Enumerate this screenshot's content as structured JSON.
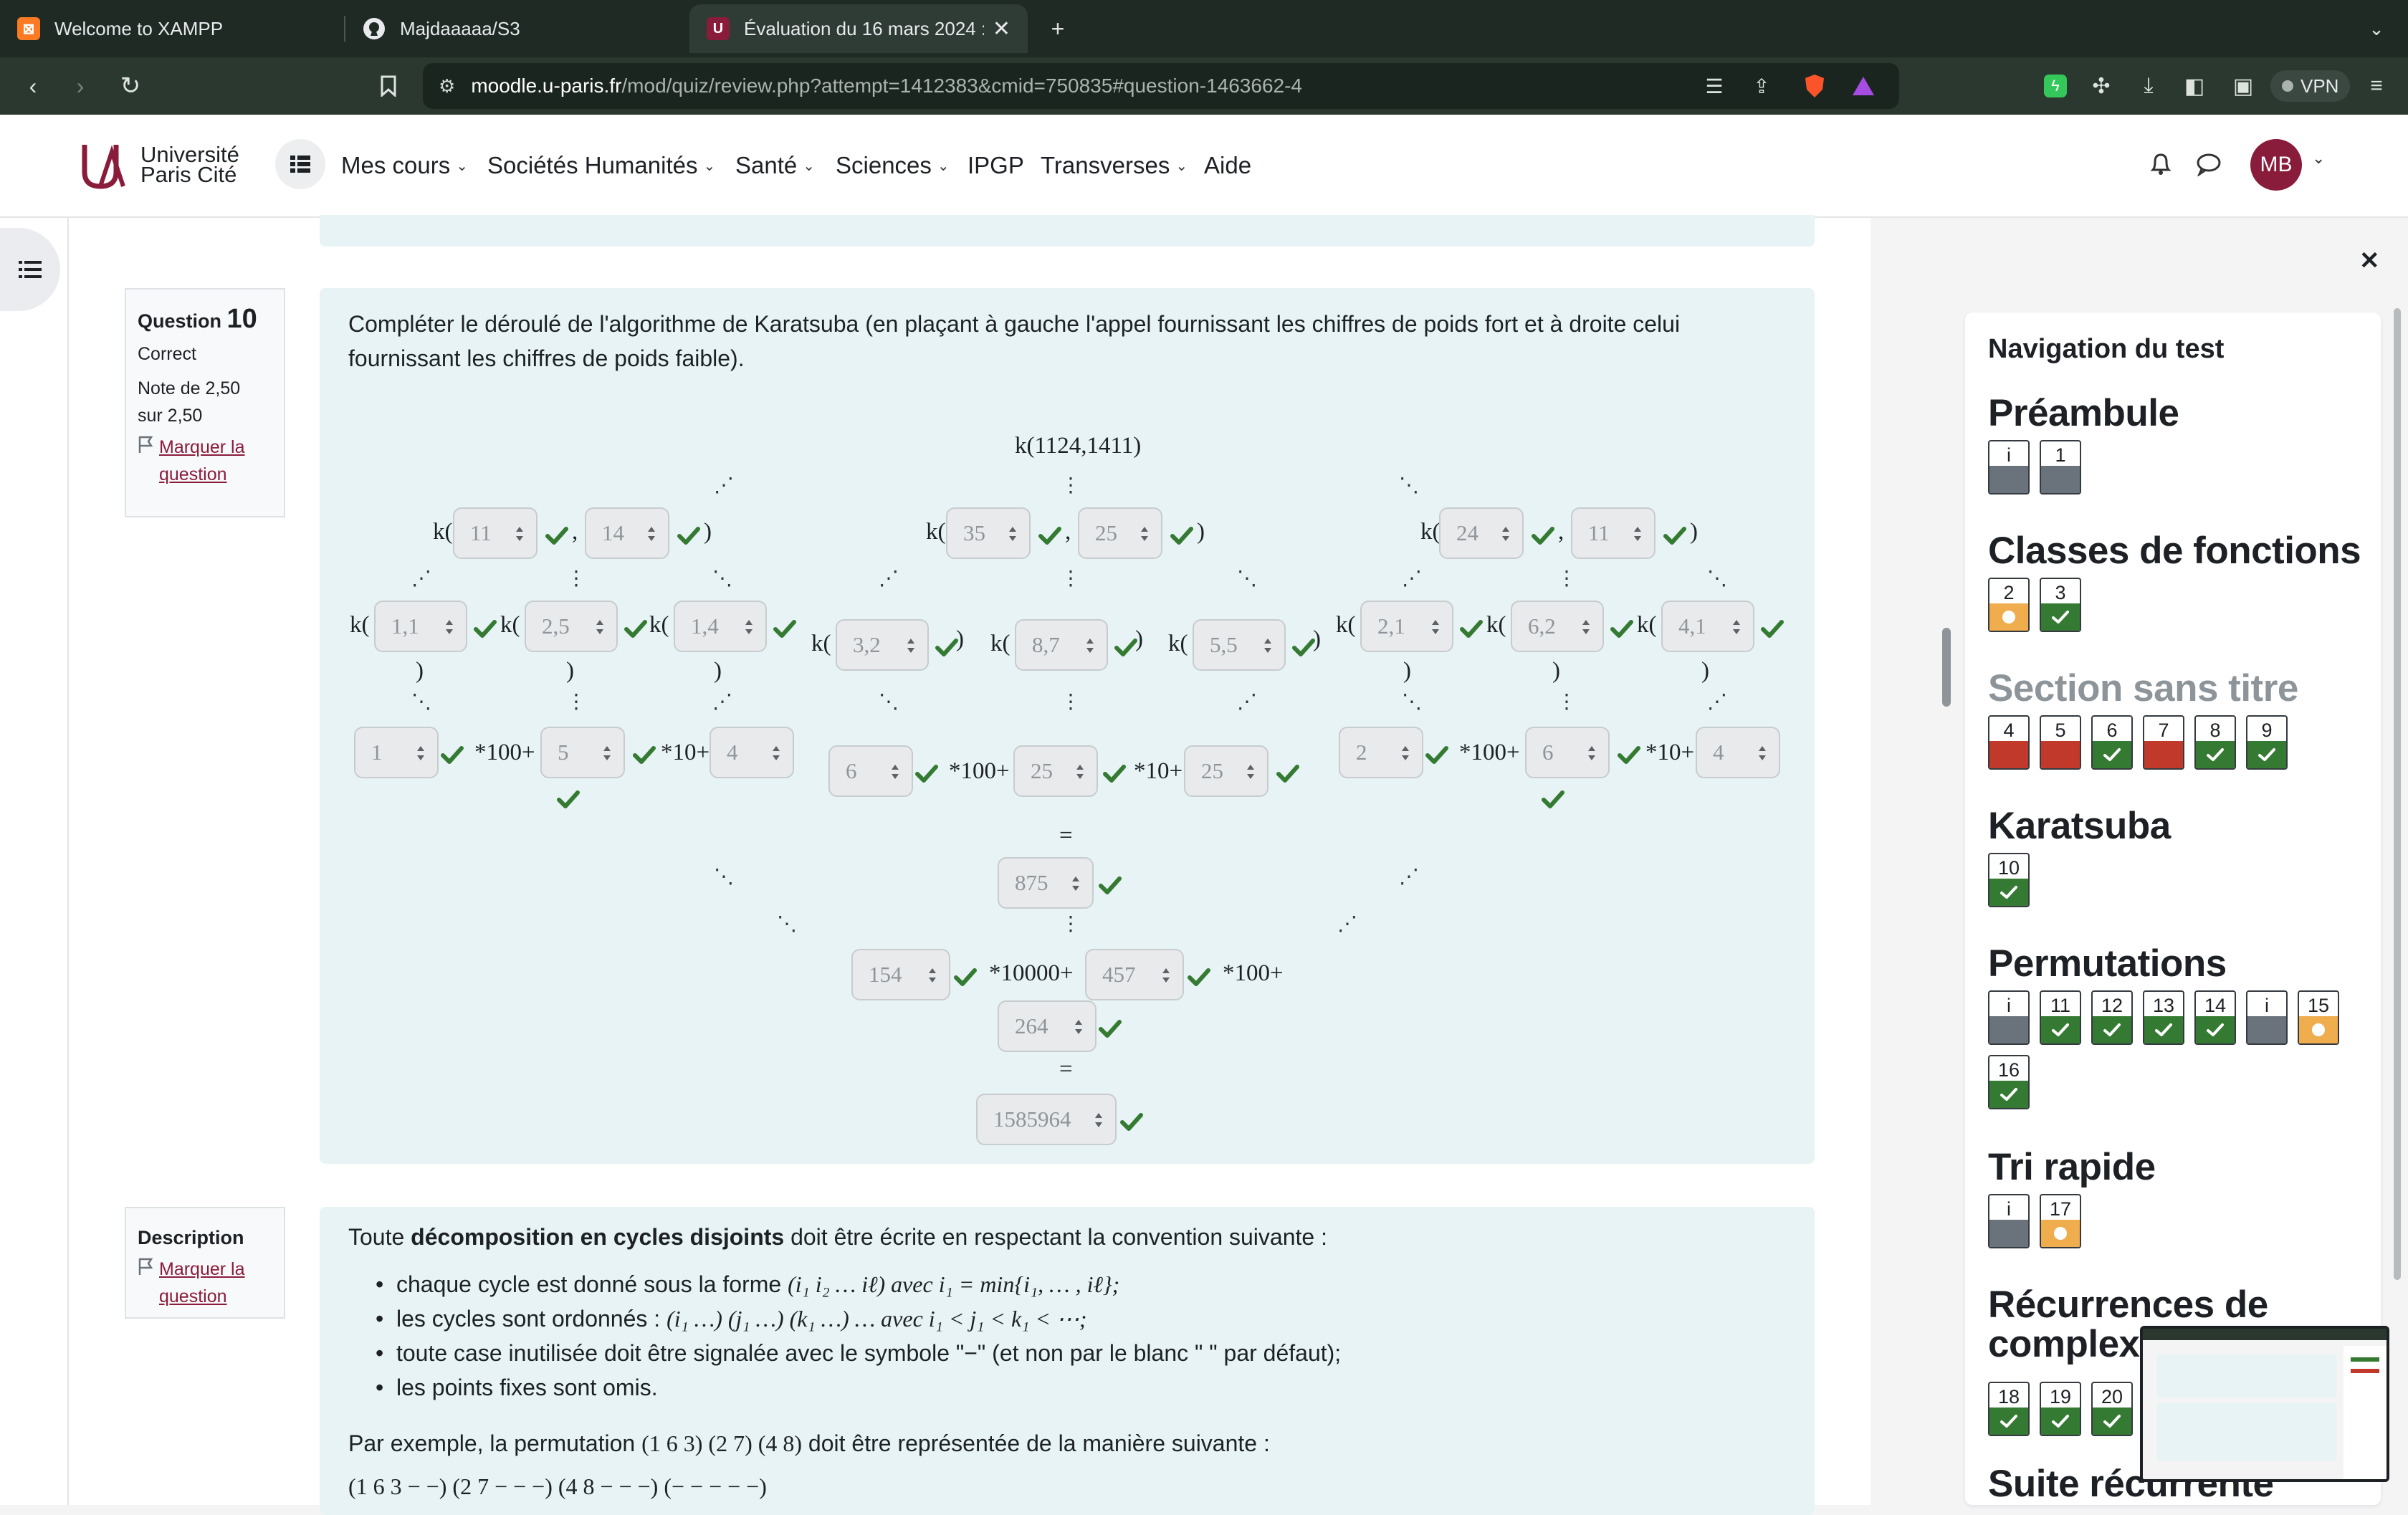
{
  "browser": {
    "tabs": [
      {
        "title": "Welcome to XAMPP",
        "icon": "xampp-icon"
      },
      {
        "title": "Majdaaaaa/S3",
        "icon": "github-icon"
      },
      {
        "title": "Évaluation du 16 mars 2024 : (",
        "icon": "moodle-icon"
      }
    ],
    "url_domain": "moodle.u-paris.fr",
    "url_path": "/mod/quiz/review.php?attempt=1412383&cmid=750835#question-1463662-4",
    "vpn_label": "VPN"
  },
  "site": {
    "logo_line1": "Université",
    "logo_line2": "Paris Cité",
    "nav": [
      "Mes cours",
      "Sociétés Humanités",
      "Santé",
      "Sciences",
      "IPGP",
      "Transverses",
      "Aide"
    ],
    "avatar_initials": "MB"
  },
  "question": {
    "label": "Question",
    "number": "10",
    "state": "Correct",
    "grade_line1": "Note de 2,50",
    "grade_line2": "sur 2,50",
    "flag_line1": "Marquer la",
    "flag_line2": "question",
    "text_line1": "Compléter le déroulé de l'algorithme de Karatsuba (en plaçant à gauche l'appel fournissant les chiffres de poids fort et à droite celui",
    "text_line2": "fournissant les chiffres de poids faible).",
    "root_call": "k(1124,1411)",
    "k_open": "k(",
    "comma": ",",
    "close_paren": ")",
    "op_100": "*100+",
    "op_10": "*10+",
    "op_10000": "*10000+",
    "equals": "=",
    "selects": {
      "l1a": "11",
      "l1b": "14",
      "m1a": "35",
      "m1b": "25",
      "r1a": "24",
      "r1b": "11",
      "l2a": "1,1",
      "l2b": "2,5",
      "l2c": "1,4",
      "m2a": "3,2",
      "m2b": "8,7",
      "m2c": "5,5",
      "r2a": "2,1",
      "r2b": "6,2",
      "r2c": "4,1",
      "l3a": "1",
      "l3b": "5",
      "l3c": "4",
      "m3a": "6",
      "m3b": "25",
      "m3c": "25",
      "r3a": "2",
      "r3b": "6",
      "r3c": "4",
      "mid": "875",
      "c1": "154",
      "c2": "457",
      "c3": "264",
      "final": "1585964"
    }
  },
  "description": {
    "label": "Description",
    "flag_line1": "Marquer la",
    "flag_line2": "question",
    "intro_pre": "Toute ",
    "intro_bold": "décomposition en cycles disjoints",
    "intro_post": " doit être écrite en respectant la convention suivante :",
    "b1_text": "chaque cycle est donné sous la forme",
    "b1_math": "(i₁  i₂  …  iℓ)    avec i₁ = min{i₁, … , iℓ};",
    "b2_text": "les cycles sont ordonnés :",
    "b2_math": "(i₁ …) (j₁ …) (k₁ …) …    avec i₁ < j₁ < k₁ < ⋯;",
    "b3": "toute case inutilisée doit être signalée avec le symbole \"−\" (et non par le blanc \" \" par défaut);",
    "b4": "les points fixes sont omis.",
    "example_text": "Par exemple, la permutation",
    "example_perm": "(1  6  3)  (2  7)  (4  8)",
    "example_post": "doit être représentée de la manière suivante :",
    "example_result": "(1 6 3  −  −) (2 7  −  − −) (4 8  −  − −) (−  −  −  −  −)"
  },
  "quiznav": {
    "title": "Navigation du test",
    "sections": [
      {
        "name": "Préambule",
        "faded": false,
        "rows": [
          [
            {
              "n": "i",
              "s": "gray"
            },
            {
              "n": "1",
              "s": "gray"
            }
          ]
        ]
      },
      {
        "name": "Classes de fonctions",
        "faded": false,
        "rows": [
          [
            {
              "n": "2",
              "s": "partial"
            },
            {
              "n": "3",
              "s": "correct"
            }
          ]
        ]
      },
      {
        "name": "Section sans titre",
        "faded": true,
        "rows": [
          [
            {
              "n": "4",
              "s": "wrong"
            },
            {
              "n": "5",
              "s": "wrong"
            },
            {
              "n": "6",
              "s": "correct"
            },
            {
              "n": "7",
              "s": "wrong"
            },
            {
              "n": "8",
              "s": "correct"
            },
            {
              "n": "9",
              "s": "correct"
            }
          ]
        ]
      },
      {
        "name": "Karatsuba",
        "faded": false,
        "rows": [
          [
            {
              "n": "10",
              "s": "correct"
            }
          ]
        ]
      },
      {
        "name": "Permutations",
        "faded": false,
        "rows": [
          [
            {
              "n": "i",
              "s": "gray"
            },
            {
              "n": "11",
              "s": "correct"
            },
            {
              "n": "12",
              "s": "correct"
            },
            {
              "n": "13",
              "s": "correct"
            },
            {
              "n": "14",
              "s": "correct"
            },
            {
              "n": "i",
              "s": "gray"
            },
            {
              "n": "15",
              "s": "partial"
            }
          ],
          [
            {
              "n": "16",
              "s": "correct"
            }
          ]
        ]
      },
      {
        "name": "Tri rapide",
        "faded": false,
        "rows": [
          [
            {
              "n": "i",
              "s": "gray"
            },
            {
              "n": "17",
              "s": "partial"
            }
          ]
        ]
      },
      {
        "name": "Récurrences de",
        "name2": "complex",
        "faded": false,
        "rows": [
          [
            {
              "n": "18",
              "s": "correct"
            },
            {
              "n": "19",
              "s": "correct"
            },
            {
              "n": "20",
              "s": "correct"
            }
          ]
        ]
      },
      {
        "name": "Suite récurrente",
        "faded": false,
        "rows": []
      }
    ],
    "colors": {
      "correct": "#357a32",
      "wrong": "#c0392b",
      "gray": "#6a737b",
      "partial": "#f0ad4e"
    }
  }
}
